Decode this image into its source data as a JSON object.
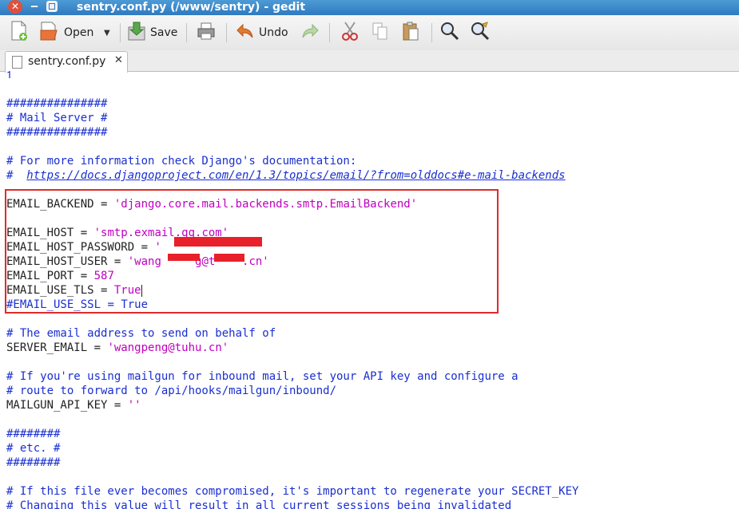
{
  "window": {
    "title": "sentry.conf.py (/www/sentry) - gedit"
  },
  "toolbar": {
    "open_label": "Open",
    "save_label": "Save",
    "undo_label": "Undo"
  },
  "tab": {
    "label": "sentry.conf.py"
  },
  "code": {
    "lines": [
      {
        "kind": "comment",
        "text": "ſ"
      },
      {
        "kind": "blank",
        "text": ""
      },
      {
        "kind": "comment",
        "text": "###############"
      },
      {
        "kind": "comment",
        "text": "# Mail Server #"
      },
      {
        "kind": "comment",
        "text": "###############"
      },
      {
        "kind": "blank",
        "text": ""
      },
      {
        "kind": "comment",
        "text": "# For more information check Django's documentation:"
      },
      {
        "kind": "comment_url",
        "text": "#  ",
        "url": "https://docs.djangoproject.com/en/1.3/topics/email/?from=olddocs#e-mail-backends"
      },
      {
        "kind": "blank",
        "text": ""
      },
      {
        "kind": "assign",
        "name": "EMAIL_BACKEND",
        "op": " = ",
        "value": "'django.core.mail.backends.smtp.EmailBackend'",
        "vkind": "string"
      },
      {
        "kind": "blank",
        "text": ""
      },
      {
        "kind": "assign",
        "name": "EMAIL_HOST",
        "op": " = ",
        "value": "'smtp.exmail.qq.com'",
        "vkind": "string"
      },
      {
        "kind": "assign",
        "name": "EMAIL_HOST_PASSWORD",
        "op": " = ",
        "value": "'",
        "vkind": "string"
      },
      {
        "kind": "assign",
        "name": "EMAIL_HOST_USER",
        "op": " = ",
        "value": "'wang     g@t    .cn'",
        "vkind": "string"
      },
      {
        "kind": "assign",
        "name": "EMAIL_PORT",
        "op": " = ",
        "value": "587",
        "vkind": "number"
      },
      {
        "kind": "assign_caret",
        "name": "EMAIL_USE_TLS",
        "op": " = ",
        "value": "True",
        "vkind": "keyword"
      },
      {
        "kind": "commented_assign",
        "name": "#EMAIL_USE_SSL",
        "op": " = ",
        "value": "True"
      },
      {
        "kind": "blank",
        "text": ""
      },
      {
        "kind": "comment",
        "text": "# The email address to send on behalf of"
      },
      {
        "kind": "assign",
        "name": "SERVER_EMAIL",
        "op": " = ",
        "value": "'wangpeng@tuhu.cn'",
        "vkind": "string"
      },
      {
        "kind": "blank",
        "text": ""
      },
      {
        "kind": "comment",
        "text": "# If you're using mailgun for inbound mail, set your API key and configure a"
      },
      {
        "kind": "comment",
        "text": "# route to forward to /api/hooks/mailgun/inbound/"
      },
      {
        "kind": "assign",
        "name": "MAILGUN_API_KEY",
        "op": " = ",
        "value": "''",
        "vkind": "string"
      },
      {
        "kind": "blank",
        "text": ""
      },
      {
        "kind": "comment",
        "text": "########"
      },
      {
        "kind": "comment",
        "text": "# etc. #"
      },
      {
        "kind": "comment",
        "text": "########"
      },
      {
        "kind": "blank",
        "text": ""
      },
      {
        "kind": "comment",
        "text": "# If this file ever becomes compromised, it's important to regenerate your SECRET_KEY"
      },
      {
        "kind": "comment",
        "text": "# Changing this value will result in all current sessions being invalidated"
      }
    ]
  },
  "colors": {
    "comment": "#1a2fd0",
    "string": "#c000c0",
    "highlight_box": "#e02a2a",
    "redaction": "#e8202a"
  }
}
